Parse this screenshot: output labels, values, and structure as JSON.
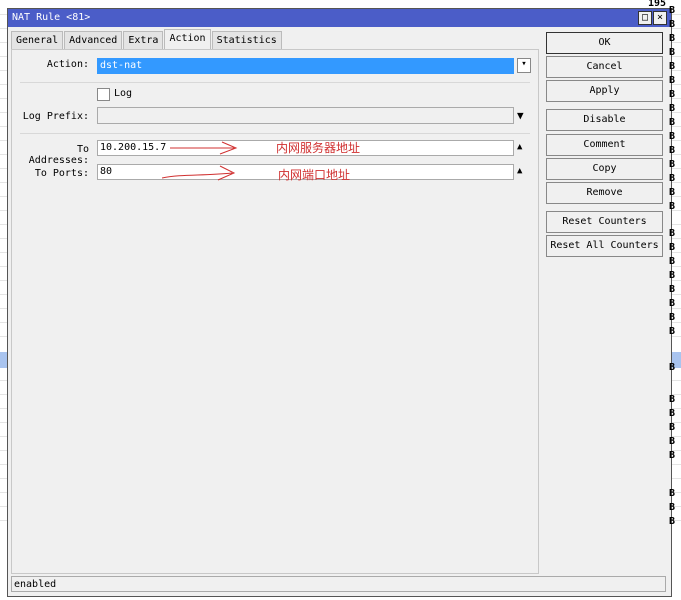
{
  "window": {
    "title": "NAT Rule <81>",
    "maximize": "□",
    "close": "×"
  },
  "tabs": [
    "General",
    "Advanced",
    "Extra",
    "Action",
    "Statistics"
  ],
  "form": {
    "action_label": "Action:",
    "action_value": "dst-nat",
    "log_label": "Log",
    "log_prefix_label": "Log Prefix:",
    "log_prefix_value": "",
    "to_addresses_label": "To Addresses:",
    "to_addresses_value": "10.200.15.7",
    "to_ports_label": "To Ports:",
    "to_ports_value": "80"
  },
  "annotations": {
    "addr": "内网服务器地址",
    "port": "内网端口地址"
  },
  "buttons": [
    "OK",
    "Cancel",
    "Apply",
    "Disable",
    "Comment",
    "Copy",
    "Remove",
    "Reset Counters",
    "Reset All Counters"
  ],
  "status": "enabled",
  "background": {
    "top_value": "195",
    "col_char": "B"
  }
}
